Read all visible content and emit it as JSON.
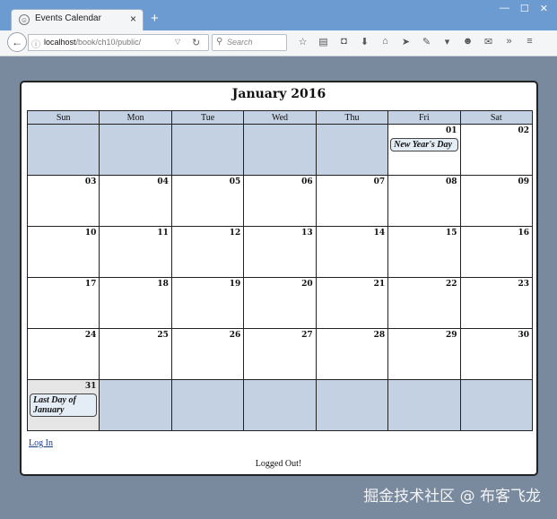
{
  "browser": {
    "tab_title": "Events Calendar",
    "tab_close": "×",
    "new_tab": "+",
    "url_host": "localhost",
    "url_path": "/book/ch10/public/",
    "search_placeholder": "Search",
    "icons": [
      "star-icon",
      "reading-list-icon",
      "pocket-icon",
      "download-icon",
      "home-icon",
      "send-icon",
      "extension-icon",
      "dropdown-icon",
      "smiley-icon",
      "chat-icon",
      "overflow-icon",
      "menu-icon"
    ]
  },
  "calendar": {
    "title": "January 2016",
    "weekdays": [
      "Sun",
      "Mon",
      "Tue",
      "Wed",
      "Thu",
      "Fri",
      "Sat"
    ],
    "weeks": [
      [
        {
          "day": ""
        },
        {
          "day": ""
        },
        {
          "day": ""
        },
        {
          "day": ""
        },
        {
          "day": ""
        },
        {
          "day": "01",
          "event": "New Year's Day"
        },
        {
          "day": "02"
        }
      ],
      [
        {
          "day": "03"
        },
        {
          "day": "04"
        },
        {
          "day": "05"
        },
        {
          "day": "06"
        },
        {
          "day": "07"
        },
        {
          "day": "08"
        },
        {
          "day": "09"
        }
      ],
      [
        {
          "day": "10"
        },
        {
          "day": "11"
        },
        {
          "day": "12"
        },
        {
          "day": "13"
        },
        {
          "day": "14"
        },
        {
          "day": "15"
        },
        {
          "day": "16"
        }
      ],
      [
        {
          "day": "17"
        },
        {
          "day": "18"
        },
        {
          "day": "19"
        },
        {
          "day": "20"
        },
        {
          "day": "21"
        },
        {
          "day": "22"
        },
        {
          "day": "23"
        }
      ],
      [
        {
          "day": "24"
        },
        {
          "day": "25"
        },
        {
          "day": "26"
        },
        {
          "day": "27"
        },
        {
          "day": "28"
        },
        {
          "day": "29"
        },
        {
          "day": "30"
        }
      ],
      [
        {
          "day": "31",
          "event": "Last Day of January",
          "today": true
        },
        {
          "day": ""
        },
        {
          "day": ""
        },
        {
          "day": ""
        },
        {
          "day": ""
        },
        {
          "day": ""
        },
        {
          "day": ""
        }
      ]
    ],
    "empty_color": "#c3d1e2",
    "header_color": "#c3d1e2"
  },
  "login_link": "Log In",
  "status_text": "Logged Out!",
  "watermark": "掘金技术社区 @ 布客飞龙"
}
